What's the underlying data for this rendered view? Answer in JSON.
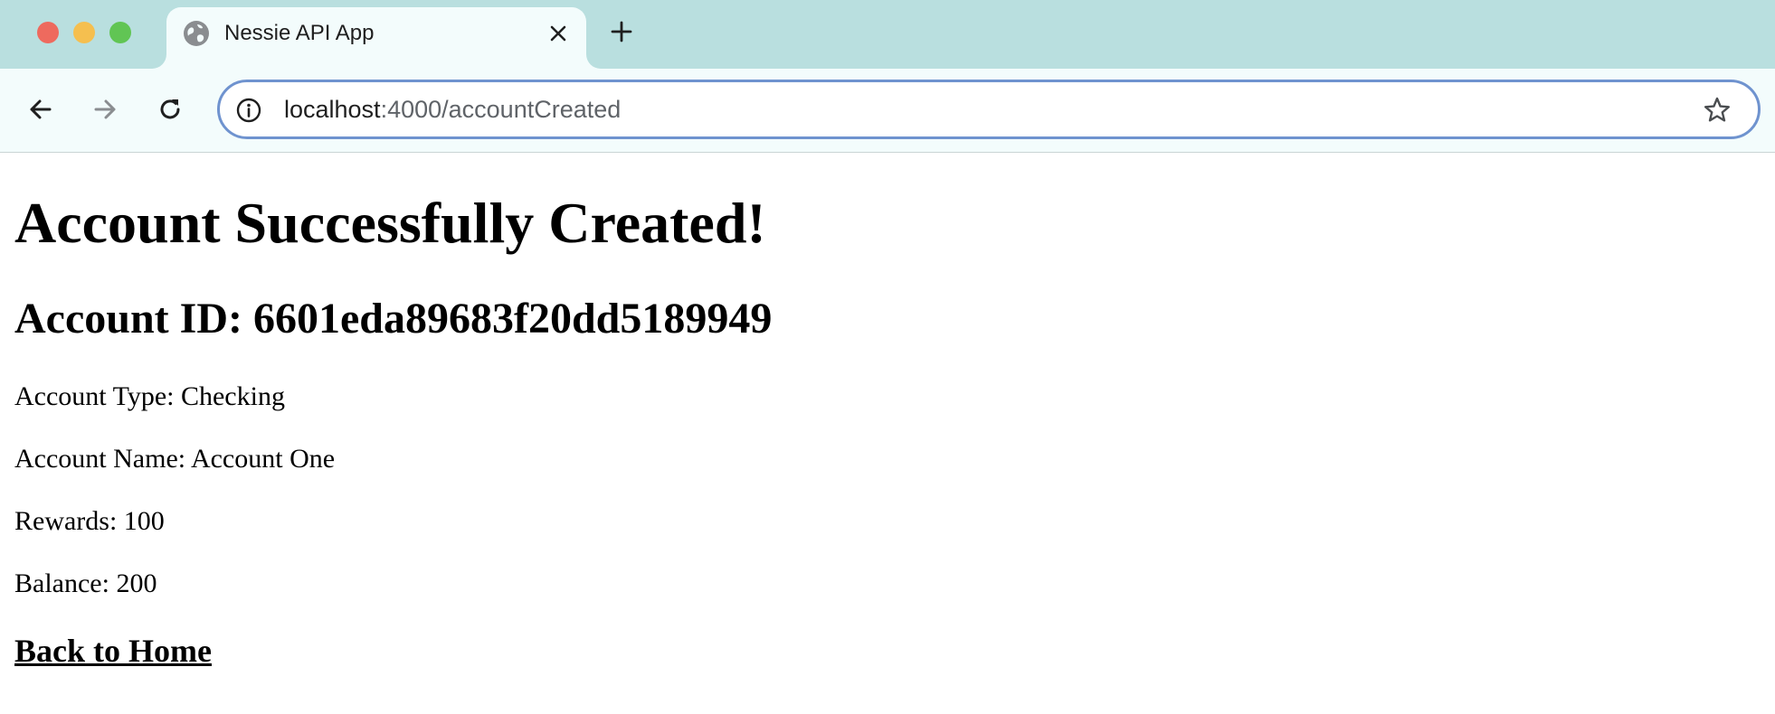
{
  "browser": {
    "tab": {
      "title": "Nessie API App"
    },
    "address_bar": {
      "host": "localhost",
      "path": ":4000/accountCreated"
    },
    "icons": {
      "favicon": "globe-icon",
      "tab_close": "close-icon",
      "new_tab": "plus-icon",
      "back": "arrow-left-icon",
      "forward": "arrow-right-icon",
      "reload": "reload-icon",
      "site_info": "info-icon",
      "bookmark": "star-icon"
    },
    "colors": {
      "tabstrip": "#b9dfdf",
      "toolbar": "#f3fcfc",
      "omnibox_border": "#6f93cf"
    }
  },
  "page": {
    "title": "Account Successfully Created!",
    "account_id": "Account ID: 6601eda89683f20dd5189949",
    "account_type": "Account Type: Checking",
    "account_name": "Account Name: Account One",
    "rewards": "Rewards: 100",
    "balance": "Balance: 200",
    "home_link": "Back to Home"
  }
}
